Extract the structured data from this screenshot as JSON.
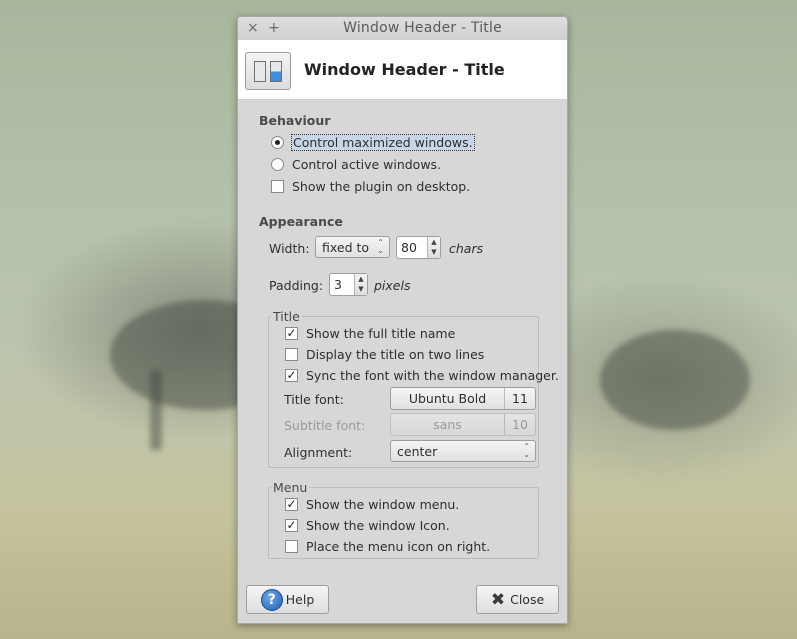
{
  "titlebar": {
    "close_glyph": "×",
    "pin_glyph": "+",
    "title": "Window Header - Title"
  },
  "header": {
    "title": "Window Header - Title",
    "icon": "toggle-switch-icon"
  },
  "behaviour": {
    "title": "Behaviour",
    "options": [
      {
        "label": "Control maximized windows.",
        "type": "radio",
        "checked": true
      },
      {
        "label": "Control active windows.",
        "type": "radio",
        "checked": false
      },
      {
        "label": "Show the plugin on desktop.",
        "type": "checkbox",
        "checked": false
      }
    ]
  },
  "appearance": {
    "title": "Appearance",
    "width_label": "Width:",
    "width_mode": "fixed to",
    "width_value": "80",
    "width_unit": "chars",
    "padding_label": "Padding:",
    "padding_value": "3",
    "padding_unit": "pixels"
  },
  "title_frame": {
    "title": "Title",
    "options": [
      {
        "label": "Show the full title name",
        "checked": true
      },
      {
        "label": "Display the title on two lines",
        "checked": false
      },
      {
        "label": "Sync the font with the window manager.",
        "checked": true
      }
    ],
    "title_font_label": "Title font:",
    "title_font_name": "Ubuntu Bold",
    "title_font_size": "11",
    "subtitle_font_label": "Subtitle font:",
    "subtitle_font_name": "sans",
    "subtitle_font_size": "10",
    "alignment_label": "Alignment:",
    "alignment_value": "center"
  },
  "menu_frame": {
    "title": "Menu",
    "options": [
      {
        "label": "Show the window menu.",
        "checked": true
      },
      {
        "label": "Show the window Icon.",
        "checked": true
      },
      {
        "label": "Place the menu icon on right.",
        "checked": false
      }
    ]
  },
  "buttons": {
    "help": "Help",
    "close": "Close"
  }
}
